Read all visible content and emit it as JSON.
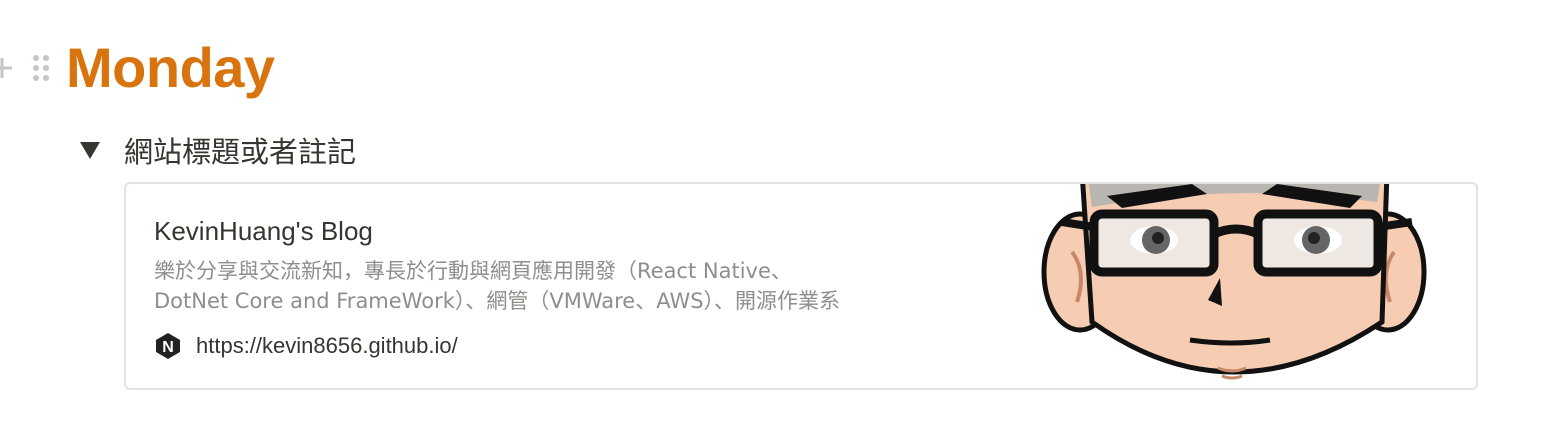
{
  "page": {
    "title": "Monday"
  },
  "toggle": {
    "label": "網站標題或者註記"
  },
  "bookmark": {
    "title": "KevinHuang's Blog",
    "description_line1": "樂於分享與交流新知，專長於行動與網頁應用開發（React Native、",
    "description_line2": "DotNet Core and FrameWork）、網管（VMWare、AWS）、開源作業系",
    "url": "https://kevin8656.github.io/",
    "favicon_letter": "N",
    "thumbnail": "cartoon-avatar-with-glasses"
  },
  "colors": {
    "title": "#d9730d",
    "text": "#37352f",
    "muted": "#8f8e8a",
    "border": "#e3e2df"
  },
  "icons": {
    "add": "plus-icon",
    "drag": "drag-handle-icon",
    "toggle": "triangle-down-icon"
  }
}
